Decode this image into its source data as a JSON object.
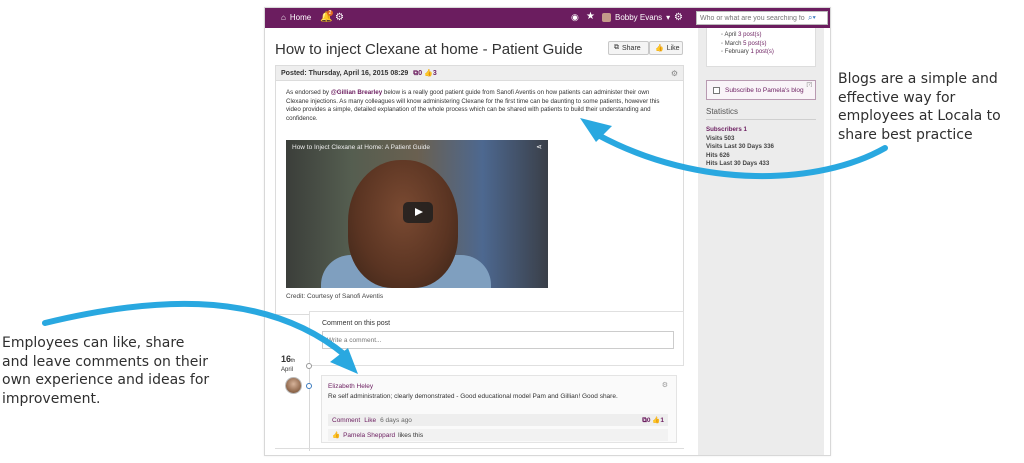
{
  "topbar": {
    "home_label": "Home",
    "notification_count": "2",
    "user_name": "Bobby Evans",
    "search_placeholder": "Who or what are you searching fo"
  },
  "post": {
    "title": "How to inject Clexane at home - Patient Guide",
    "share_label": "Share",
    "like_label": "Like",
    "posted_label": "Posted:",
    "posted_date": "Thursday, April 16, 2015 08:29",
    "comment_count": "0",
    "like_count": "3",
    "body_prefix": "As endorsed by ",
    "mention": "@Gillian Brearley",
    "body_text": " below is a really good patient guide from Sanofi Aventis on how patients can administer their own Clexane injections.  As many colleagues will know administering Clexane for the first time can be daunting to some patients, however this video provides a simple, detailed explanation of the whole process which can be shared with patients to build their understanding and confidence.",
    "video_caption": "How to Inject Clexane at Home: A Patient Guide",
    "credit": "Credit: Courtesy of Sanofi Aventis"
  },
  "comments": {
    "heading": "Comment on this post",
    "placeholder": "Write a comment...",
    "date_day": "16",
    "date_suffix": "th",
    "date_month": "April",
    "reply": {
      "author": "Elizabeth Heley",
      "text": "Re self administration; clearly demonstrated - Good educational model Pam and Gillian! Good share.",
      "comment_link": "Comment",
      "like_link": "Like",
      "ago": "6 days ago",
      "comment_count": "0",
      "like_count": "1",
      "liker": "Pamela Sheppard",
      "likes_text": "likes this"
    }
  },
  "sidebar": {
    "archive": [
      {
        "month": "April",
        "count": "3 post(s)"
      },
      {
        "month": "March",
        "count": "5 post(s)"
      },
      {
        "month": "February",
        "count": "1 post(s)"
      }
    ],
    "subscribe_label": "Subscribe to Pamela's blog",
    "subscribe_help": "[?]",
    "stats_heading": "Statistics",
    "stats": {
      "subscribers": "Subscribers 1",
      "visits": "Visits 503",
      "visits_30": "Visits Last 30 Days 336",
      "hits": "Hits 626",
      "hits_30": "Hits Last 30 Days 433"
    }
  },
  "annotations": {
    "left": "Employees can like, share and leave comments on their own experience and ideas for improvement.",
    "right": "Blogs are a simple and effective way for employees at Locala to share best practice"
  },
  "colors": {
    "brand": "#6b1d5f",
    "arrow": "#29a8e0"
  }
}
